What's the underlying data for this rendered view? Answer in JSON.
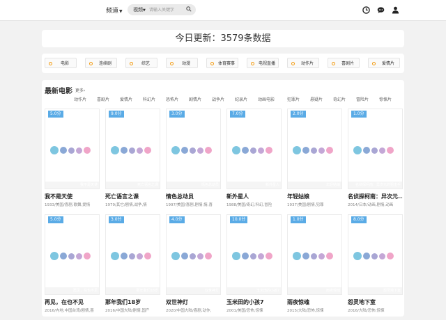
{
  "header": {
    "channel_label": "频道",
    "search_type": "视频",
    "search_placeholder": "请输入关键字"
  },
  "icons": {
    "history": "clock-icon",
    "messages": "chat-icon",
    "user": "user-icon"
  },
  "headline": "今日更新：3579条数据",
  "categories": [
    "电影",
    "连续剧",
    "综艺",
    "动漫",
    "体育赛事",
    "电视直播",
    "动作片",
    "喜剧片",
    "爱情片"
  ],
  "section": {
    "title": "最新电影",
    "more": "更多›",
    "genres": [
      "动作片",
      "喜剧片",
      "爱情片",
      "科幻片",
      "恐怖片",
      "剧情片",
      "战争片",
      "纪录片",
      "动画电影",
      "犯罪片",
      "悬疑片",
      "奇幻片",
      "冒险片",
      "惊悚片"
    ]
  },
  "movies": [
    {
      "score": "5.0分",
      "caption": "我不是天使",
      "title": "我不是天使",
      "info": "1933/美国/喜剧,歌舞,爱情"
    },
    {
      "score": "9.0分",
      "caption": "死亡语言之课",
      "title": "死亡语言之课",
      "info": "1979/其它/剧情,战争,情"
    },
    {
      "score": "3.0分",
      "caption": "情色总动员",
      "title": "情色总动员",
      "info": "1997/美国/喜剧,剧情,情,喜"
    },
    {
      "score": "7.0分",
      "caption": "新外星人",
      "title": "新外星人",
      "info": "1988/美国/奇幻,科幻,冒险"
    },
    {
      "score": "2.0分",
      "caption": "年轻姑娘",
      "title": "年轻姑娘",
      "info": "1937/美国/剧情,犯罪"
    },
    {
      "score": "1.0分",
      "caption": "名侦探柯南：异次元的狙击手",
      "title": "名侦探柯南：异次元...",
      "info": "2014/日本/动画,剧情,动画"
    },
    {
      "score": "5.0分",
      "caption": "再见，在也不见",
      "title": "再见，在也不见",
      "info": "2016/内地,中国台湾/剧情,喜"
    },
    {
      "score": "3.0分",
      "caption": "那年我们18岁",
      "title": "那年我们18岁",
      "info": "2016/中国大陆/剧情,国产"
    },
    {
      "score": "4.0分",
      "caption": "双世神灯",
      "title": "双世神灯",
      "info": "2020/中国大陆/喜剧,动作,"
    },
    {
      "score": "10.0分",
      "caption": "玉米田的小孩7",
      "title": "玉米田的小孩7",
      "info": "2001/美国/恐怖,惊悚"
    },
    {
      "score": "1.0分",
      "caption": "雨夜惊魂",
      "title": "雨夜惊魂",
      "info": "2015/大陆/恐怖,惊悚"
    },
    {
      "score": "8.0分",
      "caption": "怨灵地下室",
      "title": "怨灵地下室",
      "info": "2016/大陆/恐怖,惊悚"
    }
  ],
  "colors": {
    "score_badge": "#5aabe6",
    "ball_1": "#7ec6e0",
    "ball_2": "#8aa8d6",
    "ball_3": "#a9a6d4",
    "ball_4": "#c4a7d6",
    "ball_5": "#f0a5c8",
    "category_dot": "#f39c12"
  }
}
